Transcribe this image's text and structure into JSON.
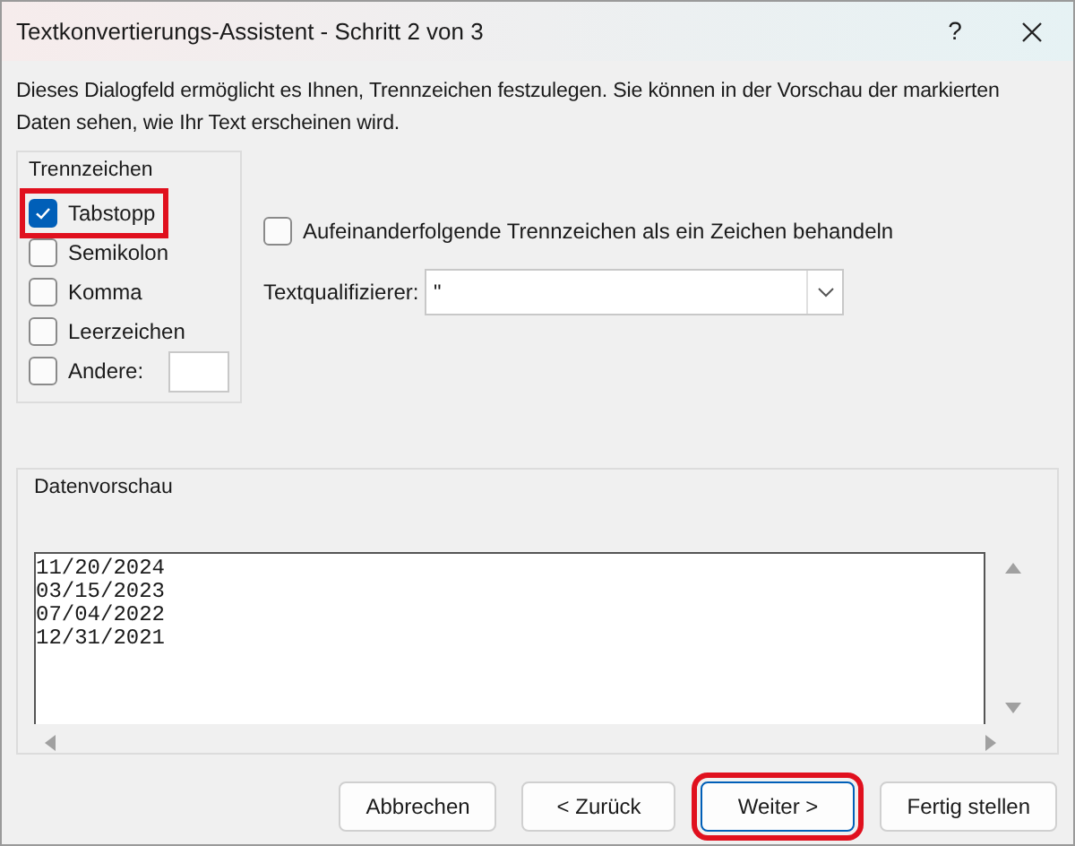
{
  "window": {
    "title": "Textkonvertierungs-Assistent - Schritt 2 von 3",
    "help": "?"
  },
  "description": "Dieses Dialogfeld ermöglicht es Ihnen, Trennzeichen festzulegen. Sie können in der Vorschau der markierten Daten sehen, wie Ihr Text erscheinen wird.",
  "delimiters": {
    "title": "Trennzeichen",
    "items": [
      {
        "label": "Tabstopp",
        "checked": true,
        "highlighted": true
      },
      {
        "label": "Semikolon",
        "checked": false,
        "highlighted": false
      },
      {
        "label": "Komma",
        "checked": false,
        "highlighted": false
      },
      {
        "label": "Leerzeichen",
        "checked": false,
        "highlighted": false
      },
      {
        "label": "Andere:",
        "checked": false,
        "highlighted": false,
        "kind": "other"
      }
    ]
  },
  "consecutive": {
    "label": "Aufeinanderfolgende Trennzeichen als ein Zeichen behandeln",
    "checked": false
  },
  "qualifier": {
    "label": "Textqualifizierer:",
    "value": "\""
  },
  "preview": {
    "title": "Datenvorschau",
    "lines": [
      "11/20/2024",
      "03/15/2023",
      "07/04/2022",
      "12/31/2021"
    ]
  },
  "buttons": [
    {
      "label": "Abbrechen",
      "highlighted": false
    },
    {
      "label": "< Zurück",
      "highlighted": false
    },
    {
      "label": "Weiter >",
      "highlighted": true
    },
    {
      "label": "Fertig stellen",
      "highlighted": false
    }
  ]
}
